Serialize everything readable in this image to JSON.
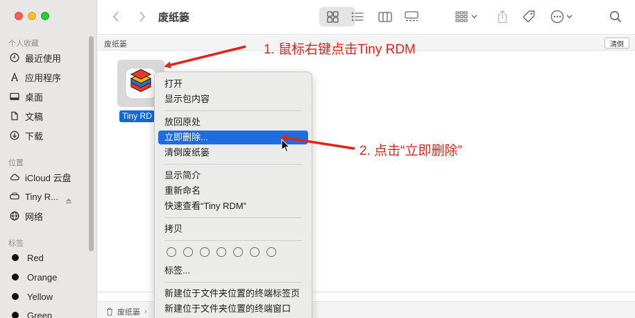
{
  "window": {
    "title": "废纸篓"
  },
  "sidebar": {
    "favorites_label": "个人收藏",
    "favorites": [
      {
        "label": "最近使用",
        "icon": "clock-icon"
      },
      {
        "label": "应用程序",
        "icon": "apps-icon"
      },
      {
        "label": "桌面",
        "icon": "desktop-icon"
      },
      {
        "label": "文稿",
        "icon": "document-icon"
      },
      {
        "label": "下载",
        "icon": "download-icon"
      }
    ],
    "locations_label": "位置",
    "locations": [
      {
        "label": "iCloud 云盘",
        "icon": "cloud-icon"
      },
      {
        "label": "Tiny R...",
        "icon": "disk-icon"
      },
      {
        "label": "网络",
        "icon": "globe-icon"
      }
    ],
    "tags_label": "标签",
    "tags": [
      {
        "label": "Red",
        "color": "#111111"
      },
      {
        "label": "Orange",
        "color": "#111111"
      },
      {
        "label": "Yellow",
        "color": "#111111"
      },
      {
        "label": "Green",
        "color": "#111111"
      }
    ]
  },
  "pathhead": {
    "label": "废纸篓",
    "empty_button": "清倒"
  },
  "file": {
    "name": "Tiny RD"
  },
  "pathbar": {
    "label": "废纸篓"
  },
  "menu": {
    "items": [
      "打开",
      "显示包内容",
      "放回原处",
      "立即删除...",
      "清倒废纸篓",
      "显示简介",
      "重新命名",
      "快速查看“Tiny RDM”",
      "拷贝",
      "标签...",
      "新建位于文件夹位置的终端标签页",
      "新建位于文件夹位置的终端窗口"
    ],
    "highlighted_index": 3
  },
  "annotations": {
    "step1": "1. 鼠标右键点击Tiny RDM",
    "step2": "2. 点击“立即删除”",
    "color": "#e2231a"
  }
}
